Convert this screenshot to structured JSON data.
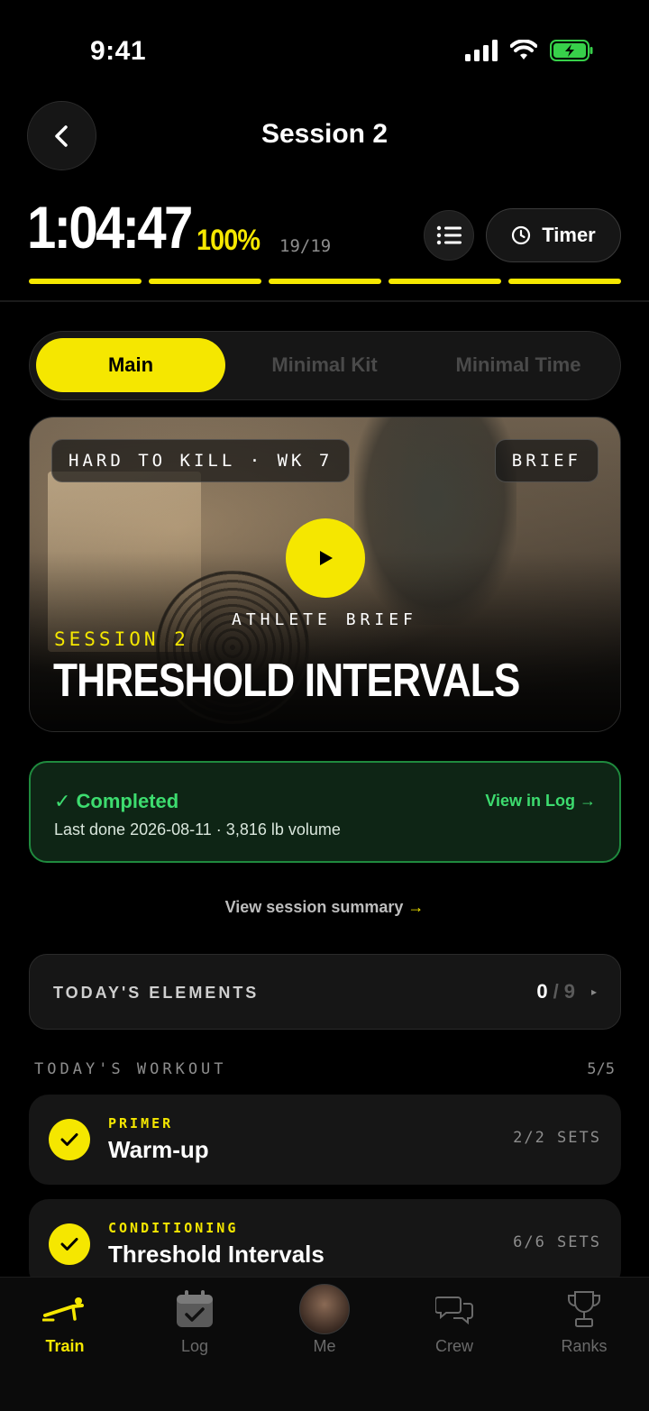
{
  "status_bar": {
    "time": "9:41"
  },
  "header": {
    "title": "Session 2"
  },
  "timer_row": {
    "elapsed": "1:04:47",
    "percent": "100%",
    "count": "19/19",
    "timer_label": "Timer",
    "progress_segments": 5,
    "progress_fraction": 1.0
  },
  "segmented": {
    "options": [
      "Main",
      "Minimal Kit",
      "Minimal Time"
    ],
    "selected": "Main"
  },
  "hero": {
    "program_tag": "HARD TO KILL · WK 7",
    "brief_tag": "BRIEF",
    "athlete_brief": "ATHLETE BRIEF",
    "session_kicker": "SESSION 2",
    "session_name": "THRESHOLD INTERVALS"
  },
  "completed": {
    "title": "✓ Completed",
    "subtitle": "Last done 2026-08-11 · 3,816 lb volume",
    "link": "View in Log →"
  },
  "summary": {
    "label": "View session summary",
    "arrow": "→"
  },
  "elements": {
    "label": "TODAY'S ELEMENTS",
    "done": "0",
    "total": "9",
    "slash": "/",
    "caret": "▸"
  },
  "workout": {
    "heading": "TODAY'S WORKOUT",
    "count": "5/5",
    "items": [
      {
        "kicker": "PRIMER",
        "name": "Warm-up",
        "sets": "2/2 SETS"
      },
      {
        "kicker": "CONDITIONING",
        "name": "Threshold Intervals",
        "sets": "6/6 SETS"
      }
    ]
  },
  "tabbar": {
    "tabs": [
      {
        "label": "Train",
        "icon": "pushup-icon"
      },
      {
        "label": "Log",
        "icon": "calendar-check-icon"
      },
      {
        "label": "Me",
        "icon": "avatar"
      },
      {
        "label": "Crew",
        "icon": "chat-bubbles-icon"
      },
      {
        "label": "Ranks",
        "icon": "trophy-icon"
      }
    ],
    "active": "Train"
  },
  "colors": {
    "accent": "#f5e700",
    "success": "#3ddc6f",
    "background": "#000000"
  }
}
